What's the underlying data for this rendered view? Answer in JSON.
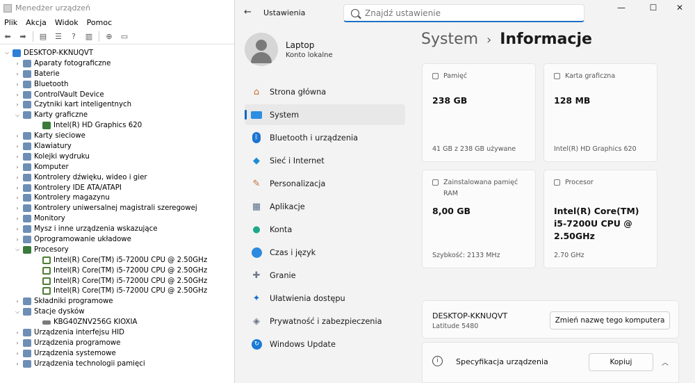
{
  "device_manager": {
    "title": "Menedżer urządzeń",
    "menu": [
      "Plik",
      "Akcja",
      "Widok",
      "Pomoc"
    ],
    "toolbar": [
      "back-icon",
      "forward-icon",
      "properties-icon",
      "list-icon",
      "help-icon",
      "list-icon",
      "scan-icon",
      "monitor-icon"
    ],
    "tree": [
      {
        "level": 0,
        "expanded": true,
        "icon": "computer",
        "label": "DESKTOP-KKNUQVT"
      },
      {
        "level": 1,
        "expanded": false,
        "icon": "cat",
        "label": "Aparaty fotograficzne"
      },
      {
        "level": 1,
        "expanded": false,
        "icon": "cat",
        "label": "Baterie"
      },
      {
        "level": 1,
        "expanded": false,
        "icon": "cat",
        "label": "Bluetooth"
      },
      {
        "level": 1,
        "expanded": false,
        "icon": "cat",
        "label": "ControlVault Device"
      },
      {
        "level": 1,
        "expanded": false,
        "icon": "cat",
        "label": "Czytniki kart inteligentnych"
      },
      {
        "level": 1,
        "expanded": true,
        "icon": "cat",
        "label": "Karty graficzne"
      },
      {
        "level": 2,
        "expanded": null,
        "icon": "gpu",
        "label": "Intel(R) HD Graphics 620"
      },
      {
        "level": 1,
        "expanded": false,
        "icon": "cat",
        "label": "Karty sieciowe"
      },
      {
        "level": 1,
        "expanded": false,
        "icon": "cat",
        "label": "Klawiatury"
      },
      {
        "level": 1,
        "expanded": false,
        "icon": "cat",
        "label": "Kolejki wydruku"
      },
      {
        "level": 1,
        "expanded": false,
        "icon": "cat",
        "label": "Komputer"
      },
      {
        "level": 1,
        "expanded": false,
        "icon": "cat",
        "label": "Kontrolery dźwięku, wideo i gier"
      },
      {
        "level": 1,
        "expanded": false,
        "icon": "cat",
        "label": "Kontrolery IDE ATA/ATAPI"
      },
      {
        "level": 1,
        "expanded": false,
        "icon": "cat",
        "label": "Kontrolery magazynu"
      },
      {
        "level": 1,
        "expanded": false,
        "icon": "cat",
        "label": "Kontrolery uniwersalnej magistrali szeregowej"
      },
      {
        "level": 1,
        "expanded": false,
        "icon": "cat",
        "label": "Monitory"
      },
      {
        "level": 1,
        "expanded": false,
        "icon": "cat",
        "label": "Mysz i inne urządzenia wskazujące"
      },
      {
        "level": 1,
        "expanded": false,
        "icon": "cat",
        "label": "Oprogramowanie układowe"
      },
      {
        "level": 1,
        "expanded": true,
        "icon": "gpu",
        "label": "Procesory"
      },
      {
        "level": 2,
        "expanded": null,
        "icon": "cpu",
        "label": "Intel(R) Core(TM) i5-7200U CPU @ 2.50GHz"
      },
      {
        "level": 2,
        "expanded": null,
        "icon": "cpu",
        "label": "Intel(R) Core(TM) i5-7200U CPU @ 2.50GHz"
      },
      {
        "level": 2,
        "expanded": null,
        "icon": "cpu",
        "label": "Intel(R) Core(TM) i5-7200U CPU @ 2.50GHz"
      },
      {
        "level": 2,
        "expanded": null,
        "icon": "cpu",
        "label": "Intel(R) Core(TM) i5-7200U CPU @ 2.50GHz"
      },
      {
        "level": 1,
        "expanded": false,
        "icon": "cat",
        "label": "Składniki programowe"
      },
      {
        "level": 1,
        "expanded": true,
        "icon": "cat",
        "label": "Stacje dysków"
      },
      {
        "level": 2,
        "expanded": null,
        "icon": "disk",
        "label": "KBG40ZNV256G KIOXIA"
      },
      {
        "level": 1,
        "expanded": false,
        "icon": "cat",
        "label": "Urządzenia interfejsu HID"
      },
      {
        "level": 1,
        "expanded": false,
        "icon": "cat",
        "label": "Urządzenia programowe"
      },
      {
        "level": 1,
        "expanded": false,
        "icon": "cat",
        "label": "Urządzenia systemowe"
      },
      {
        "level": 1,
        "expanded": false,
        "icon": "cat",
        "label": "Urządzenia technologii pamięci"
      }
    ]
  },
  "settings": {
    "app_title": "Ustawienia",
    "search_placeholder": "Znajdź ustawienie",
    "window_controls": {
      "minimize": "—",
      "maximize": "☐",
      "close": "✕"
    },
    "profile": {
      "name": "Laptop",
      "account_type": "Konto lokalne"
    },
    "nav": [
      {
        "id": "home",
        "label": "Strona główna",
        "icon": "home-icon",
        "glyph": "⌂",
        "cls": "ic-home",
        "active": false
      },
      {
        "id": "system",
        "label": "System",
        "icon": "system-icon",
        "glyph": "",
        "cls": "ic-system",
        "active": true
      },
      {
        "id": "bluetooth",
        "label": "Bluetooth i urządzenia",
        "icon": "bluetooth-icon",
        "glyph": "ᛒ",
        "cls": "ic-bt",
        "active": false
      },
      {
        "id": "network",
        "label": "Sieć i Internet",
        "icon": "wifi-icon",
        "glyph": "◆",
        "cls": "ic-wifi",
        "active": false
      },
      {
        "id": "personalization",
        "label": "Personalizacja",
        "icon": "brush-icon",
        "glyph": "✎",
        "cls": "ic-brush",
        "active": false
      },
      {
        "id": "apps",
        "label": "Aplikacje",
        "icon": "apps-icon",
        "glyph": "▦",
        "cls": "ic-apps",
        "active": false
      },
      {
        "id": "accounts",
        "label": "Konta",
        "icon": "user-icon",
        "glyph": "●",
        "cls": "ic-user",
        "active": false
      },
      {
        "id": "time",
        "label": "Czas i język",
        "icon": "clock-icon",
        "glyph": "",
        "cls": "ic-time",
        "active": false
      },
      {
        "id": "gaming",
        "label": "Granie",
        "icon": "gamepad-icon",
        "glyph": "✚",
        "cls": "ic-game",
        "active": false
      },
      {
        "id": "accessibility",
        "label": "Ułatwienia dostępu",
        "icon": "accessibility-icon",
        "glyph": "✦",
        "cls": "ic-access",
        "active": false
      },
      {
        "id": "privacy",
        "label": "Prywatność i zabezpieczenia",
        "icon": "shield-icon",
        "glyph": "◈",
        "cls": "ic-shield",
        "active": false
      },
      {
        "id": "update",
        "label": "Windows Update",
        "icon": "update-icon",
        "glyph": "↻",
        "cls": "ic-update",
        "active": false
      }
    ],
    "breadcrumb": {
      "parent": "System",
      "separator": "›",
      "current": "Informacje"
    },
    "cards": {
      "memory": {
        "label": "Pamięć",
        "value": "238 GB",
        "sub": "41 GB z 238 GB używane"
      },
      "gpu": {
        "label": "Karta graficzna",
        "value": "128 MB",
        "sub": "Intel(R) HD Graphics 620"
      },
      "ram": {
        "label": "Zainstalowana pamięć RAM",
        "value": "8,00 GB",
        "sub": "Szybkość: 2133 MHz"
      },
      "cpu": {
        "label": "Procesor",
        "value": "Intel(R) Core(TM) i5-7200U CPU @ 2.50GHz",
        "sub": "2.70 GHz"
      }
    },
    "device": {
      "name": "DESKTOP-KKNUQVT",
      "model": "Latitude 5480",
      "rename_button": "Zmień nazwę tego komputera"
    },
    "spec": {
      "title": "Specyfikacja urządzenia",
      "copy_button": "Kopiuj",
      "collapse_glyph": "︿"
    }
  }
}
